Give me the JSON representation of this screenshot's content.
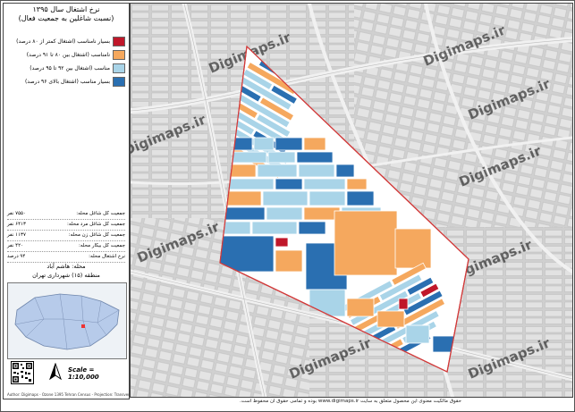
{
  "title": {
    "line1": "نرخ اشتغال سال ۱۳۹۵",
    "line2": "(نسبت شاغلین به جمعیت فعال)"
  },
  "legend": [
    {
      "label": "بسیار نامناسب (اشتغال کمتر از ۸۰ درصد)",
      "color": "#c0172a"
    },
    {
      "label": "نامناسب (اشتغال بین ۸۰ تا ۹۱ درصد)",
      "color": "#f5a85e"
    },
    {
      "label": "مناسب (اشتغال بین ۹۲ تا ۹۵ درصد)",
      "color": "#a9d4e8"
    },
    {
      "label": "بسیار مناسب (اشتغال بالای ۹۶ درصد)",
      "color": "#2a6fb1"
    }
  ],
  "stats": [
    {
      "label": "جمعیت کل شاغل محله:",
      "value": "۷۵۵۰ نفر"
    },
    {
      "label": "جمعیت کل شاغل مرد محله:",
      "value": "۶۴۱۳ نفر"
    },
    {
      "label": "جمعیت کل شاغل زن محله:",
      "value": "۱۱۳۷ نفر"
    },
    {
      "label": "جمعیت کل بیکار محله:",
      "value": "۴۲۰ نفر"
    },
    {
      "label": "نرخ اشتغال محله:",
      "value": "۹۴ درصد"
    }
  ],
  "location": {
    "neighborhood": "محله: هاشم آباد",
    "district": "منطقه (۱۵) شهرداری تهران"
  },
  "scale": "Scale = 1:10,000",
  "north": "N",
  "credit": "Author: Digimaps - Ozone 1395 Tehran Census - Projection: Transverse Mercator",
  "watermark": "Digimaps.ir",
  "footer": "حقوق مالکیت معنوی این محصول متعلق به سایت www.digimaps.ir بوده و تمامی حقوق آن محفوظ است.",
  "icons": {
    "north_arrow": "north-arrow-icon",
    "qr": "qr-code-icon"
  }
}
